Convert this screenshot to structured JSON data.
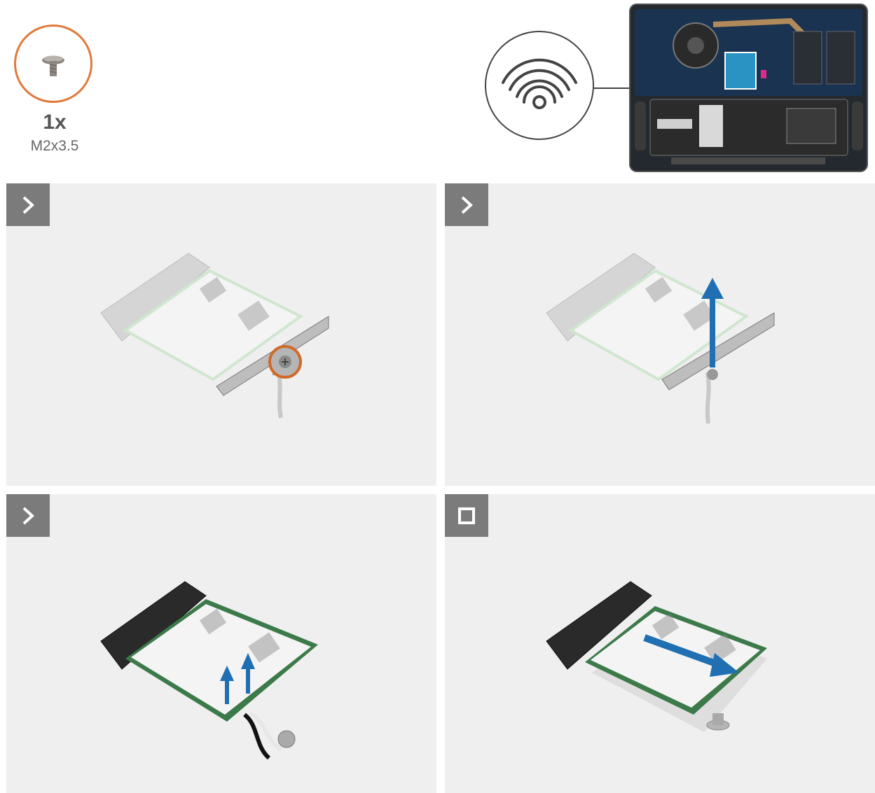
{
  "screw": {
    "quantity": "1x",
    "size": "M2x3.5",
    "circle_color": "#e07a3b"
  },
  "locator": {
    "icon": "wifi-icon",
    "highlight_color": "#2fa3d8"
  },
  "steps": [
    {
      "icon": "chevron-right-icon",
      "arrow_color": "#1f6fb2"
    },
    {
      "icon": "chevron-right-icon",
      "arrow_color": "#1f6fb2"
    },
    {
      "icon": "chevron-right-icon",
      "arrow_color": "#1f6fb2"
    },
    {
      "icon": "square-stop-icon",
      "arrow_color": "#1f6fb2"
    }
  ]
}
